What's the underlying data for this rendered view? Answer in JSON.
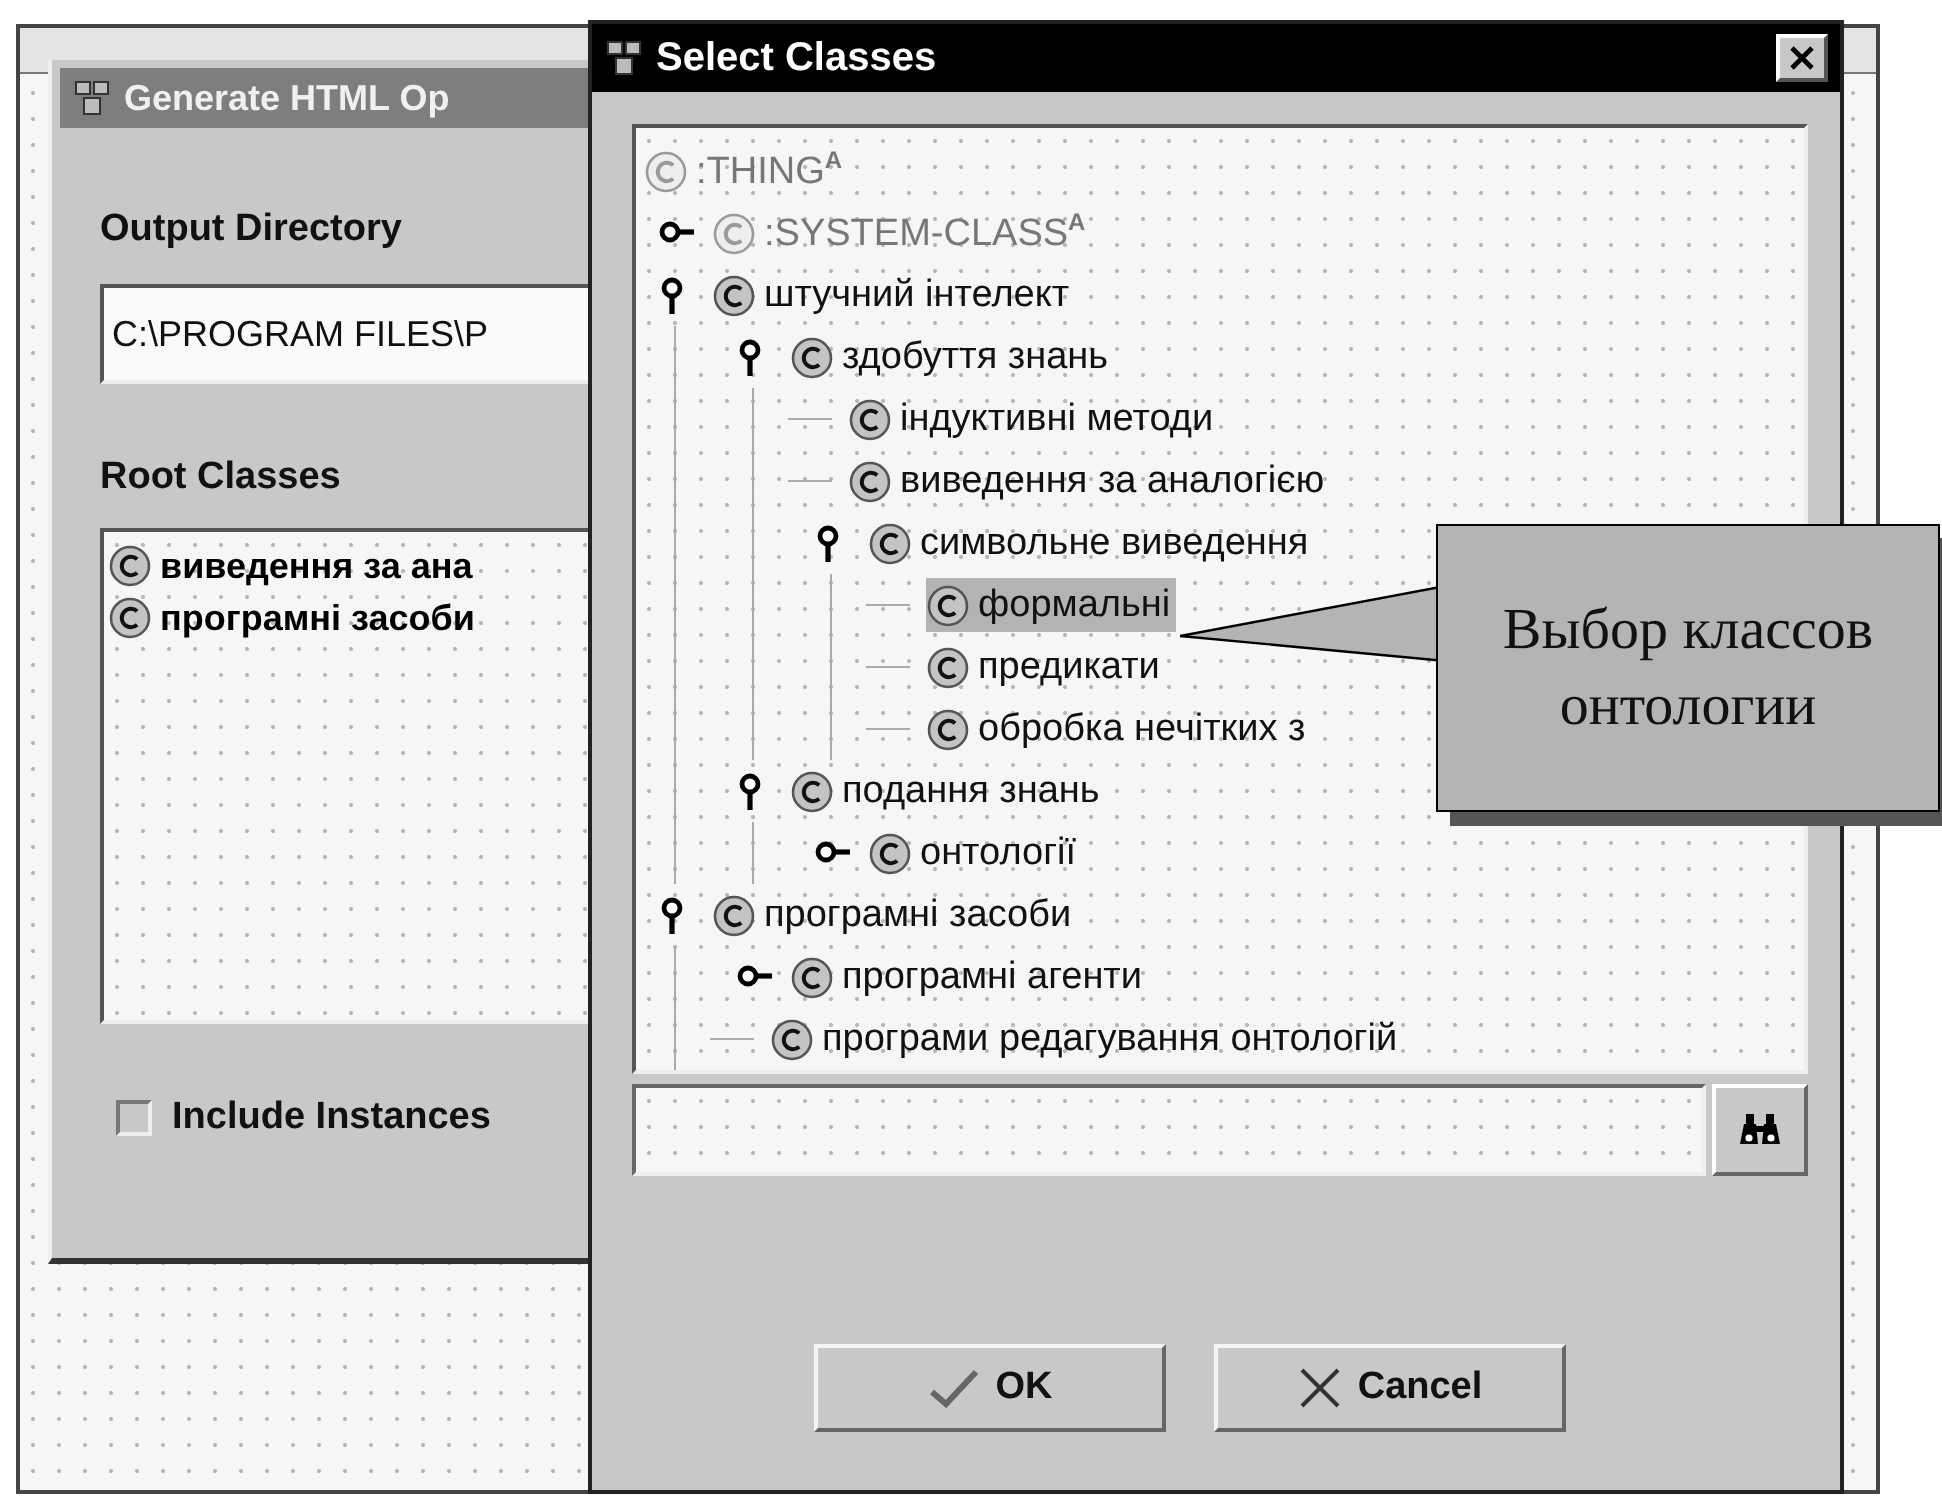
{
  "options_dialog": {
    "title": "Generate HTML Op",
    "output_directory_label": "Output Directory",
    "output_directory": "C:\\PROGRAM FILES\\P",
    "root_classes_label": "Root Classes",
    "root_classes": [
      "виведення за ана",
      "програмні засоби"
    ],
    "include_instances": {
      "label": "Include Instances",
      "checked": false
    }
  },
  "select_dialog": {
    "title": "Select Classes",
    "tree": [
      {
        "label": ":THING$^{A}$",
        "kind": "system",
        "selected": false,
        "children": [
          {
            "label": ":SYSTEM-CLASS$^{A}$",
            "kind": "system",
            "selected": false,
            "expanded": false
          },
          {
            "label": "штучний інтелект",
            "kind": "class",
            "selected": false,
            "expanded": true,
            "children": [
              {
                "label": "здобуття знань",
                "kind": "class",
                "selected": false,
                "expanded": true,
                "children": [
                  {
                    "label": "індуктивні методи",
                    "kind": "class",
                    "selected": false
                  },
                  {
                    "label": "виведення за аналогією",
                    "kind": "class",
                    "selected": false
                  },
                  {
                    "label": "символьне виведення",
                    "kind": "class",
                    "selected": false,
                    "expanded": true,
                    "children": [
                      {
                        "label": "формальні",
                        "kind": "class",
                        "selected": true
                      },
                      {
                        "label": "предикати",
                        "kind": "class",
                        "selected": false
                      },
                      {
                        "label": "обробка нечітких з",
                        "kind": "class",
                        "selected": false
                      }
                    ]
                  }
                ]
              },
              {
                "label": "подання знань",
                "kind": "class",
                "selected": false,
                "expanded": true,
                "children": [
                  {
                    "label": "онтології",
                    "kind": "class",
                    "selected": false,
                    "expanded": false
                  }
                ]
              }
            ]
          },
          {
            "label": "програмні засоби",
            "kind": "class",
            "selected": false,
            "expanded": true,
            "children": [
              {
                "label": "програмні агенти",
                "kind": "class",
                "selected": false,
                "expanded": false
              },
              {
                "label": "програми редагування онтологій",
                "kind": "class",
                "selected": false
              }
            ]
          }
        ]
      }
    ],
    "buttons": [
      {
        "label": "OK",
        "kind": "ok"
      },
      {
        "label": "Cancel",
        "kind": "cancel"
      }
    ]
  },
  "callout": {
    "text": "Выбор классов онтологии"
  }
}
